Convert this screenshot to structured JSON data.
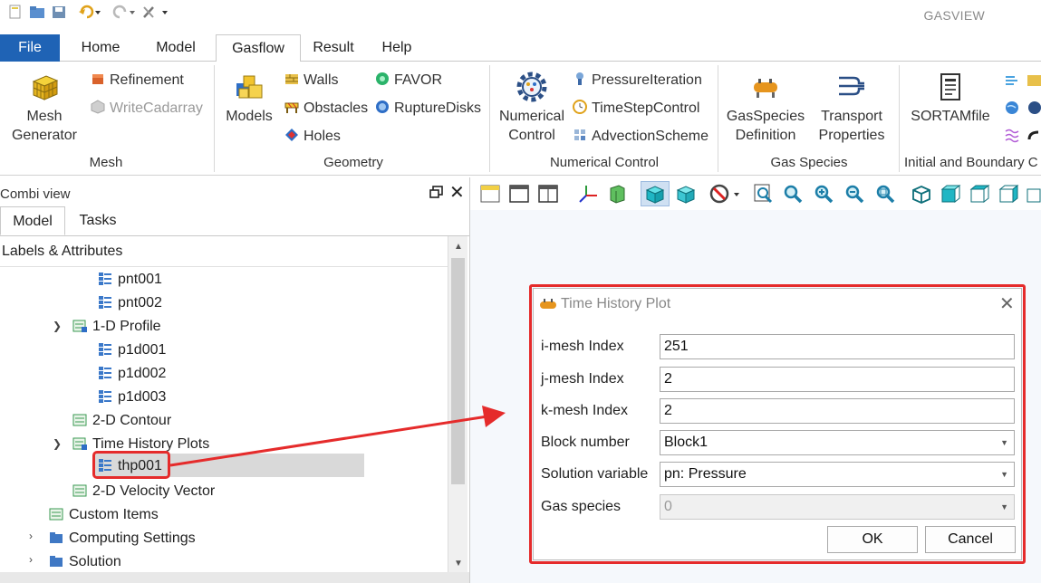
{
  "app": {
    "title": "GASVIEW"
  },
  "menu": {
    "tabs": [
      "File",
      "Home",
      "Model",
      "Gasflow",
      "Result",
      "Help"
    ],
    "active": "Gasflow"
  },
  "ribbon": {
    "mesh": {
      "label": "Mesh",
      "mesh_generator": [
        "Mesh",
        "Generator"
      ],
      "refinement": "Refinement",
      "write_cadarray": "WriteCadarray"
    },
    "geometry": {
      "label": "Geometry",
      "models": "Models",
      "walls": "Walls",
      "obstacles": "Obstacles",
      "holes": "Holes",
      "favor": "FAVOR",
      "rupture_disks": "RuptureDisks"
    },
    "numerical_control": {
      "label": "Numerical Control",
      "numerical_control": [
        "Numerical",
        "Control"
      ],
      "pressure_iteration": "PressureIteration",
      "time_step_control": "TimeStepControl",
      "advection_scheme": "AdvectionScheme"
    },
    "gas_species": {
      "label": "Gas Species",
      "gas_species_definition": [
        "GasSpecies",
        "Definition"
      ],
      "transport_properties": [
        "Transport",
        "Properties"
      ]
    },
    "initial_boundary": {
      "label": "Initial and Boundary C",
      "sortam_file": "SORTAMfile"
    }
  },
  "combi": {
    "title": "Combi view",
    "tabs": [
      "Model",
      "Tasks"
    ],
    "tree_header": "Labels & Attributes",
    "tree": {
      "pnt001": "pnt001",
      "pnt002": "pnt002",
      "profile_1d": "1-D Profile",
      "p1d001": "p1d001",
      "p1d002": "p1d002",
      "p1d003": "p1d003",
      "contour_2d": "2-D Contour",
      "time_history_plots": "Time History Plots",
      "thp001": "thp001",
      "velocity_vector_2d": "2-D Velocity Vector",
      "custom_items": "Custom Items",
      "computing_settings": "Computing Settings",
      "solution": "Solution"
    }
  },
  "dialog": {
    "title": "Time History Plot",
    "fields": {
      "i_mesh": {
        "label": "i-mesh Index",
        "value": "251"
      },
      "j_mesh": {
        "label": "j-mesh Index",
        "value": "2"
      },
      "k_mesh": {
        "label": "k-mesh Index",
        "value": "2"
      },
      "block": {
        "label": "Block number",
        "value": "Block1"
      },
      "solution_variable": {
        "label": "Solution variable",
        "value": "pn: Pressure"
      },
      "gas_species": {
        "label": "Gas species",
        "value": "0"
      }
    },
    "ok_label": "OK",
    "cancel_label": "Cancel"
  },
  "colors": {
    "accent": "#1f63b5",
    "highlight": "#e52b2b",
    "selection": "#d9d9d9"
  }
}
